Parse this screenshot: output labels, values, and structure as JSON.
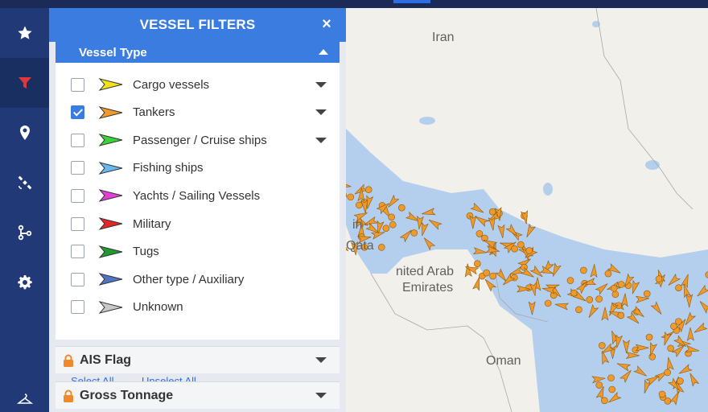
{
  "rail": {
    "items": [
      {
        "name": "favorites",
        "icon": "star-icon"
      },
      {
        "name": "filters",
        "icon": "filter-icon",
        "active": true
      },
      {
        "name": "places",
        "icon": "map-pin-icon"
      },
      {
        "name": "satellite",
        "icon": "satellite-icon"
      },
      {
        "name": "routes",
        "icon": "route-icon"
      },
      {
        "name": "settings",
        "icon": "gear-icon"
      }
    ]
  },
  "panel": {
    "title": "VESSEL FILTERS",
    "close_glyph": "×",
    "section_title": "Vessel Type",
    "vessel_types": [
      {
        "label": "Cargo vessels",
        "color": "#f2e21c",
        "checked": false,
        "expandable": true
      },
      {
        "label": "Tankers",
        "color": "#f09a2b",
        "checked": true,
        "expandable": true
      },
      {
        "label": "Passenger / Cruise ships",
        "color": "#3ad13a",
        "checked": false,
        "expandable": true
      },
      {
        "label": "Fishing ships",
        "color": "#67b7f0",
        "checked": false,
        "expandable": false
      },
      {
        "label": "Yachts / Sailing Vessels",
        "color": "#e23fd6",
        "checked": false,
        "expandable": false
      },
      {
        "label": "Military",
        "color": "#e02828",
        "checked": false,
        "expandable": false
      },
      {
        "label": "Tugs",
        "color": "#1f9a2e",
        "checked": false,
        "expandable": false
      },
      {
        "label": "Other type / Auxiliary",
        "color": "#4f74c4",
        "checked": false,
        "expandable": false
      },
      {
        "label": "Unknown",
        "color": "#c8c8c8",
        "checked": false,
        "expandable": false
      }
    ],
    "select_all": "Select All",
    "unselect_all": "Unselect All",
    "accordions": [
      {
        "label": "AIS Flag"
      },
      {
        "label": "Gross Tonnage"
      }
    ]
  },
  "map": {
    "labels": {
      "iran": "Iran",
      "uae_line1": "nited Arab",
      "uae_line2": "Emirates",
      "oman": "Oman",
      "qatar": "Qata",
      "bahrain": "in"
    },
    "water_color": "#b4cfed",
    "land_color": "#f1f0ea",
    "tanker_color": "#f09a2b"
  }
}
